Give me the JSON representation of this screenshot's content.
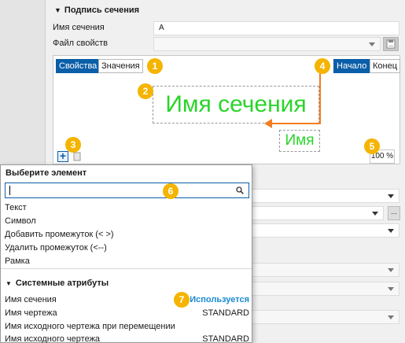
{
  "section": {
    "title": "Подпись сечения"
  },
  "form": {
    "name_label": "Имя сечения",
    "name_value": "А",
    "props_file_label": "Файл свойств",
    "props_file_value": ""
  },
  "tabs": {
    "properties": "Свойства",
    "values": "Значения",
    "start": "Начало",
    "end": "Конец"
  },
  "canvas": {
    "main_text": "Имя сечения",
    "attr_text": "Имя",
    "zoom": "100 %",
    "add_symbol": "+"
  },
  "badges": [
    "1",
    "2",
    "3",
    "4",
    "5",
    "6",
    "7"
  ],
  "dropdown": {
    "title": "Выберите элемент",
    "search_placeholder": "",
    "items": [
      "Текст",
      "Символ",
      "Добавить промежуток  (< >)",
      "Удалить промежуток  (<--)",
      "Рамка"
    ],
    "group_title": "Системные атрибуты",
    "attributes": [
      {
        "name": "Имя сечения",
        "value": "Используется"
      },
      {
        "name": "Имя чертежа",
        "value": "STANDARD"
      },
      {
        "name": "Имя исходного чертежа при перемещении",
        "value": ""
      },
      {
        "name": "Имя исходного чертежа",
        "value": "STANDARD"
      }
    ]
  },
  "colors": {
    "accent": "#0b5ea8",
    "badge": "#f4b400",
    "preview_text": "#2bd42b",
    "arrow": "#f57c21",
    "used": "#1a8ad4"
  }
}
